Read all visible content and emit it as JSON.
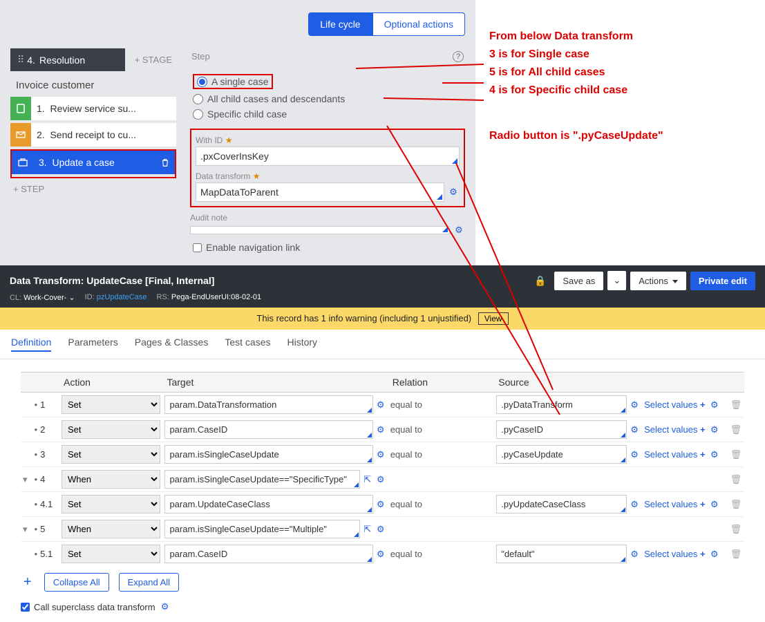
{
  "case_designer": {
    "tabs": {
      "life_cycle": "Life cycle",
      "optional_actions": "Optional actions"
    },
    "stage": {
      "num": "4.",
      "name": "Resolution",
      "add_stage": "+ STAGE"
    },
    "process": {
      "name": "Invoice customer",
      "add_step": "+ STEP"
    },
    "steps": [
      {
        "num": "1.",
        "label": "Review service su..."
      },
      {
        "num": "2.",
        "label": "Send receipt to cu..."
      },
      {
        "num": "3.",
        "label": "Update a case"
      }
    ],
    "panel": {
      "title": "Step",
      "radios": {
        "single": "A single case",
        "all": "All child cases and descendants",
        "specific": "Specific child case"
      },
      "with_id_label": "With ID",
      "with_id_value": ".pxCoverInsKey",
      "dt_label": "Data transform",
      "dt_value": "MapDataToParent",
      "audit_label": "Audit note",
      "audit_value": "",
      "enable_nav": "Enable navigation link"
    }
  },
  "annotations": {
    "l0": "From below Data transform",
    "l1": "3 is for Single case",
    "l2": "5 is for All child cases",
    "l3": "4 is for Specific child case",
    "l4": "Radio button is \".pyCaseUpdate\""
  },
  "rule_header": {
    "title": "Data Transform: UpdateCase [Final, Internal]",
    "cl_label": "CL:",
    "cl_value": "Work-Cover-",
    "id_label": "ID:",
    "id_value": "pzUpdateCase",
    "rs_label": "RS:",
    "rs_value": "Pega-EndUserUI:08-02-01",
    "save_as": "Save as",
    "actions": "Actions",
    "private_edit": "Private edit"
  },
  "warning": {
    "text": "This record has 1 info warning (including 1 unjustified)",
    "view": "View"
  },
  "tabs": [
    "Definition",
    "Parameters",
    "Pages & Classes",
    "Test cases",
    "History"
  ],
  "table": {
    "headers": {
      "action": "Action",
      "target": "Target",
      "relation": "Relation",
      "source": "Source"
    },
    "select_values": "Select values",
    "rows": [
      {
        "n": "1",
        "action": "Set",
        "target": "param.DataTransformation",
        "relation": "equal to",
        "source": ".pyDataTransform"
      },
      {
        "n": "2",
        "action": "Set",
        "target": "param.CaseID",
        "relation": "equal to",
        "source": ".pyCaseID"
      },
      {
        "n": "3",
        "action": "Set",
        "target": "param.isSingleCaseUpdate",
        "relation": "equal to",
        "source": ".pyCaseUpdate"
      },
      {
        "n": "4",
        "action": "When",
        "target": "param.isSingleCaseUpdate==\"SpecificType\"",
        "relation": "",
        "source": ""
      },
      {
        "n": "4.1",
        "action": "Set",
        "target": "param.UpdateCaseClass",
        "relation": "equal to",
        "source": ".pyUpdateCaseClass"
      },
      {
        "n": "5",
        "action": "When",
        "target": "param.isSingleCaseUpdate==\"Multiple\"",
        "relation": "",
        "source": ""
      },
      {
        "n": "5.1",
        "action": "Set",
        "target": "param.CaseID",
        "relation": "equal to",
        "source": "\"default\""
      }
    ]
  },
  "footer": {
    "collapse": "Collapse All",
    "expand": "Expand All",
    "superclass": "Call superclass data transform"
  }
}
